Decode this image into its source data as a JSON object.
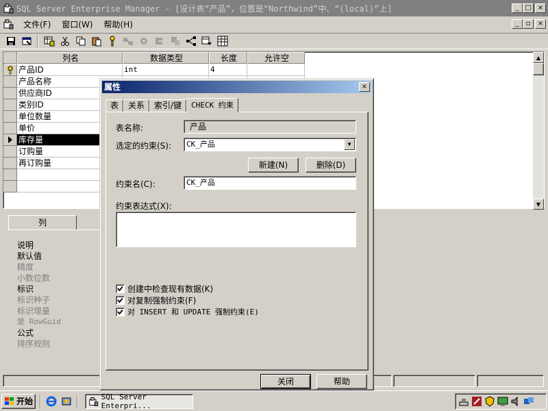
{
  "window": {
    "title": "SQL Server Enterprise Manager - [设计表“产品”，位置是“Northwind”中、“(local)”上]",
    "minimize": "_",
    "maximize": "□",
    "close": "×"
  },
  "menubar": {
    "items": [
      "文件(F)",
      "窗口(W)",
      "帮助(H)"
    ],
    "mdi_min": "_",
    "mdi_restore": "▫",
    "mdi_close": "×"
  },
  "grid": {
    "headers": [
      "列名",
      "数据类型",
      "长度",
      "允许空"
    ],
    "rows": [
      {
        "name": "产品ID",
        "type": "int",
        "length": "4",
        "nullable": "",
        "key": true
      },
      {
        "name": "产品名称",
        "type": "",
        "length": "",
        "nullable": ""
      },
      {
        "name": "供应商ID",
        "type": "",
        "length": "",
        "nullable": ""
      },
      {
        "name": "类别ID",
        "type": "",
        "length": "",
        "nullable": ""
      },
      {
        "name": "单位数量",
        "type": "",
        "length": "",
        "nullable": ""
      },
      {
        "name": "单价",
        "type": "",
        "length": "",
        "nullable": ""
      },
      {
        "name": "库存量",
        "type": "",
        "length": "",
        "nullable": "",
        "selected": true
      },
      {
        "name": "订购量",
        "type": "",
        "length": "",
        "nullable": ""
      },
      {
        "name": "再订购量",
        "type": "",
        "length": "",
        "nullable": ""
      },
      {
        "name": "",
        "type": "",
        "length": "",
        "nullable": ""
      },
      {
        "name": "",
        "type": "",
        "length": "",
        "nullable": ""
      }
    ]
  },
  "lower_panel": {
    "tab": "列",
    "properties": [
      {
        "label": "说明",
        "enabled": true
      },
      {
        "label": "默认值",
        "enabled": true
      },
      {
        "label": "精度",
        "enabled": false
      },
      {
        "label": "小数位数",
        "enabled": false
      },
      {
        "label": "标识",
        "enabled": true
      },
      {
        "label": "标识种子",
        "enabled": false
      },
      {
        "label": "标识增量",
        "enabled": false
      },
      {
        "label": "是 RowGuid",
        "enabled": false
      },
      {
        "label": "公式",
        "enabled": true
      },
      {
        "label": "排序规则",
        "enabled": false
      }
    ]
  },
  "dialog": {
    "title": "属性",
    "close": "×",
    "tabs": [
      "表",
      "关系",
      "索引/键",
      "CHECK 约束"
    ],
    "active_tab": 3,
    "table_name_label": "表名称:",
    "table_name_value": "产品",
    "selected_constraint_label": "选定的约束(S):",
    "selected_constraint_value": "CK_产品",
    "new_button": "新建(N)",
    "delete_button": "删除(D)",
    "constraint_name_label": "约束名(C):",
    "constraint_name_value": "CK_产品",
    "expression_label": "约束表达式(X):",
    "expression_value": "",
    "checkboxes": [
      {
        "label": "创建中检查现有数据(K)",
        "checked": true
      },
      {
        "label": "对复制强制约束(F)",
        "checked": true
      },
      {
        "label": "对 INSERT 和 UPDATE 强制约束(E)",
        "checked": true
      }
    ],
    "close_button": "关闭",
    "help_button": "帮助"
  },
  "taskbar": {
    "start": "开始",
    "task_item": "SQL Server Enterpri..."
  },
  "colors": {
    "titlebar_inactive": "#808080",
    "dialog_title_start": "#0a246a",
    "dialog_title_end": "#a6caf0",
    "face": "#d4d0c8"
  }
}
